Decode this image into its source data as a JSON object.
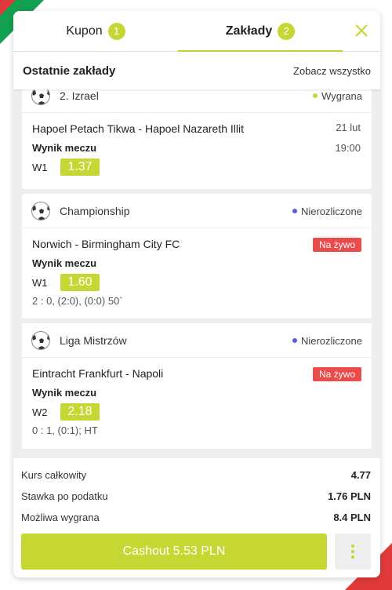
{
  "tabs": [
    {
      "label": "Kupon",
      "count": "1"
    },
    {
      "label": "Zakłady",
      "count": "2"
    }
  ],
  "close_icon": "close-icon",
  "header": {
    "title": "Ostatnie zakłady",
    "see_all": "Zobacz wszystko"
  },
  "bets": [
    {
      "league": "2. Izrael",
      "status": "Wygrana",
      "status_color": "#c6d632",
      "match": "Hapoel Petach Tikwa - Hapoel Nazareth Illit",
      "date": "21 lut",
      "time": "19:00",
      "market": "Wynik meczu",
      "pick": "W1",
      "odd": "1.37"
    },
    {
      "league": "Championship",
      "status": "Nierozliczone",
      "status_color": "#5b5be0",
      "match": "Norwich - Birmingham City FC",
      "live": "Na żywo",
      "market": "Wynik meczu",
      "pick": "W1",
      "odd": "1.60",
      "score": "2 : 0, (2:0), (0:0) 50`"
    },
    {
      "league": "Liga Mistrzów",
      "status": "Nierozliczone",
      "status_color": "#5b5be0",
      "match": "Eintracht Frankfurt - Napoli",
      "live": "Na żywo",
      "market": "Wynik meczu",
      "pick": "W2",
      "odd": "2.18",
      "score": "0 : 1, (0:1); HT"
    }
  ],
  "summary": {
    "total_odds_label": "Kurs całkowity",
    "total_odds": "4.77",
    "stake_label": "Stawka po podatku",
    "stake": "1.76 PLN",
    "win_label": "Możliwa wygrana",
    "win": "8.4 PLN"
  },
  "cashout_label": "Cashout 5.53 PLN",
  "colors": {
    "accent": "#c6d632",
    "live": "#ec4b4b",
    "unsettled": "#5b5be0"
  }
}
